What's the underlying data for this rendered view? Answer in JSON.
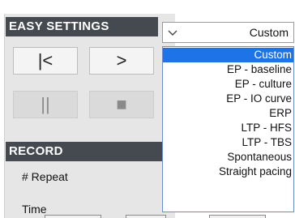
{
  "easy_settings": {
    "title": "EASY SETTINGS",
    "dropdown": {
      "value": "Custom",
      "icon": "chevron-down-icon",
      "options": [
        "Custom",
        "EP - baseline",
        "EP - culture",
        "EP - IO curve",
        "ERP",
        "LTP - HFS",
        "LTP - TBS",
        "Spontaneous",
        "Straight pacing"
      ],
      "selected_index": 0
    },
    "controls": {
      "first_label": "|<",
      "next_label": ">",
      "pause_label": "||",
      "stop_label": "■"
    }
  },
  "record": {
    "title": "RECORD",
    "repeat_label": "# Repeat",
    "time_label": "Time"
  },
  "colors": {
    "header_bg": "#444a4f",
    "panel_bg": "#e6e6e6",
    "selection": "#1e73e8",
    "list_border": "#6a8fd0"
  }
}
